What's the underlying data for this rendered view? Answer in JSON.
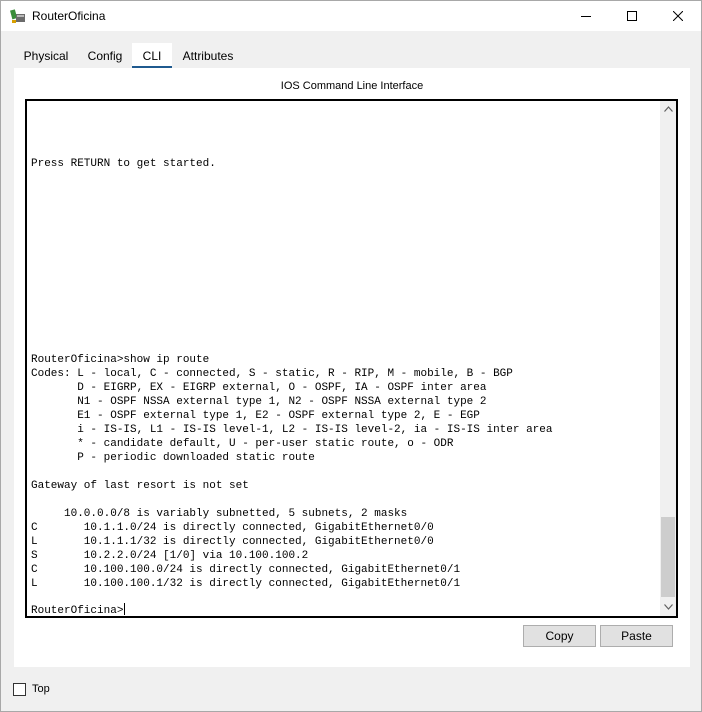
{
  "window": {
    "title": "RouterOficina"
  },
  "tabs": [
    {
      "label": "Physical",
      "active": false
    },
    {
      "label": "Config",
      "active": false
    },
    {
      "label": "CLI",
      "active": true
    },
    {
      "label": "Attributes",
      "active": false
    }
  ],
  "panel": {
    "title": "IOS Command Line Interface"
  },
  "terminal": {
    "lines": [
      "",
      "",
      "",
      "",
      "Press RETURN to get started.",
      "",
      "",
      "",
      "",
      "",
      "",
      "",
      "",
      "",
      "",
      "",
      "",
      "",
      "RouterOficina>show ip route",
      "Codes: L - local, C - connected, S - static, R - RIP, M - mobile, B - BGP",
      "       D - EIGRP, EX - EIGRP external, O - OSPF, IA - OSPF inter area",
      "       N1 - OSPF NSSA external type 1, N2 - OSPF NSSA external type 2",
      "       E1 - OSPF external type 1, E2 - OSPF external type 2, E - EGP",
      "       i - IS-IS, L1 - IS-IS level-1, L2 - IS-IS level-2, ia - IS-IS inter area",
      "       * - candidate default, U - per-user static route, o - ODR",
      "       P - periodic downloaded static route",
      "",
      "Gateway of last resort is not set",
      "",
      "     10.0.0.0/8 is variably subnetted, 5 subnets, 2 masks",
      "C       10.1.1.0/24 is directly connected, GigabitEthernet0/0",
      "L       10.1.1.1/32 is directly connected, GigabitEthernet0/0",
      "S       10.2.2.0/24 [1/0] via 10.100.100.2",
      "C       10.100.100.0/24 is directly connected, GigabitEthernet0/1",
      "L       10.100.100.1/32 is directly connected, GigabitEthernet0/1",
      ""
    ],
    "prompt": "RouterOficina>"
  },
  "buttons": {
    "copy": "Copy",
    "paste": "Paste"
  },
  "top_checkbox": {
    "label": "Top",
    "checked": false
  },
  "colors": {
    "active_tab_underline": "#1f5a8f",
    "terminal_border": "#000000",
    "button_bg": "#e1e1e1"
  }
}
